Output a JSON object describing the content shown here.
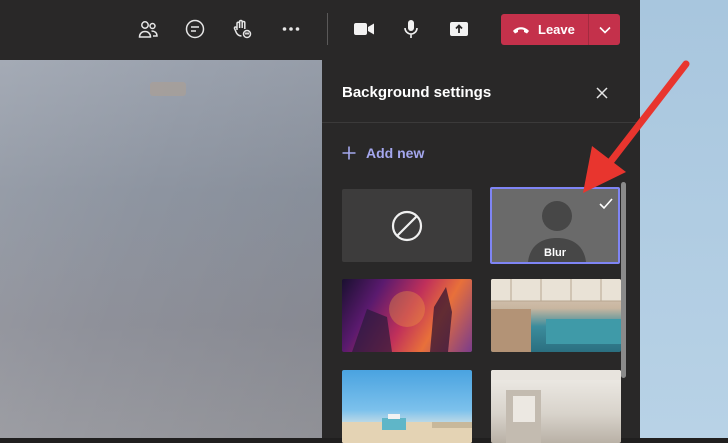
{
  "toolbar": {
    "icons": [
      "people-icon",
      "chat-icon",
      "raise-hand-icon",
      "more-options-icon",
      "camera-icon",
      "microphone-icon",
      "share-screen-icon"
    ],
    "leave_label": "Leave",
    "leave_color": "#c4314b"
  },
  "panel": {
    "title": "Background settings",
    "add_new_label": "Add new",
    "accent_color": "#a4a7ee",
    "selected_border_color": "#7f85f5",
    "backgrounds": [
      {
        "name": "none",
        "icon": "no-background-icon",
        "selected": false
      },
      {
        "name": "blur",
        "label": "Blur",
        "selected": true
      },
      {
        "name": "artwork",
        "selected": false
      },
      {
        "name": "office",
        "selected": false
      },
      {
        "name": "beach",
        "selected": false
      },
      {
        "name": "room",
        "selected": false
      }
    ]
  },
  "annotation": {
    "arrow_color": "#e8352e"
  }
}
